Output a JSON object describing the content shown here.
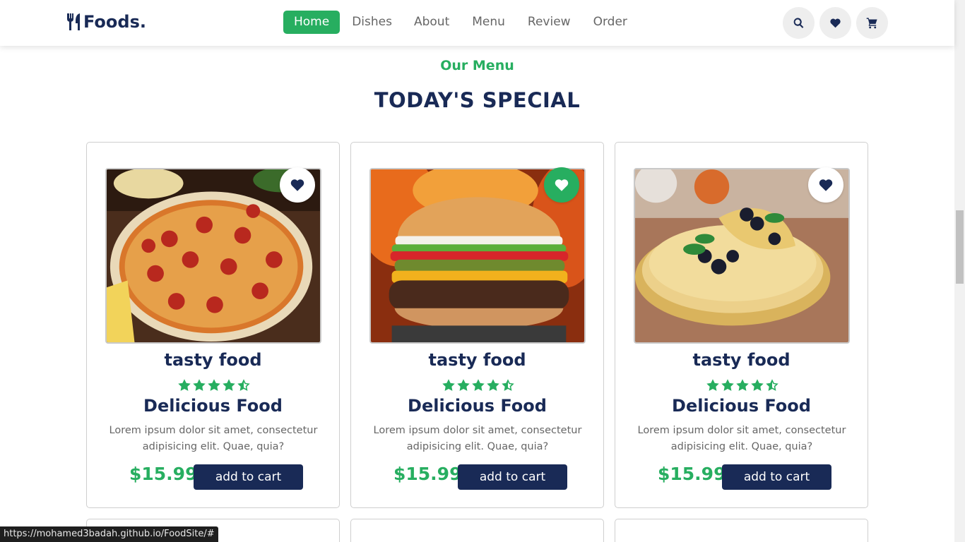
{
  "header": {
    "logo_text": "Foods.",
    "nav": [
      {
        "label": "Home",
        "active": true
      },
      {
        "label": "Dishes",
        "active": false
      },
      {
        "label": "About",
        "active": false
      },
      {
        "label": "Menu",
        "active": false
      },
      {
        "label": "Review",
        "active": false
      },
      {
        "label": "Order",
        "active": false
      }
    ],
    "icons": [
      "search-icon",
      "heart-icon",
      "cart-icon"
    ]
  },
  "section": {
    "sub_heading": "Our Menu",
    "heading": "TODAY'S SPECIAL"
  },
  "cards": [
    {
      "image": "pizza",
      "favorited": false,
      "title": "tasty food",
      "rating": 4.5,
      "name": "Delicious Food",
      "description": "Lorem ipsum dolor sit amet, consectetur adipisicing elit. Quae, quia?",
      "price": "$15.99",
      "button": "add to cart"
    },
    {
      "image": "burger",
      "favorited": true,
      "title": "tasty food",
      "rating": 4.5,
      "name": "Delicious Food",
      "description": "Lorem ipsum dolor sit amet, consectetur adipisicing elit. Quae, quia?",
      "price": "$15.99",
      "button": "add to cart"
    },
    {
      "image": "crepes",
      "favorited": false,
      "title": "tasty food",
      "rating": 4.5,
      "name": "Delicious Food",
      "description": "Lorem ipsum dolor sit amet, consectetur adipisicing elit. Quae, quia?",
      "price": "$15.99",
      "button": "add to cart"
    }
  ],
  "status_url": "https://mohamed3badah.github.io/FoodSite/#",
  "colors": {
    "primary": "#192a56",
    "accent": "#27ae60",
    "text_muted": "#666666"
  }
}
